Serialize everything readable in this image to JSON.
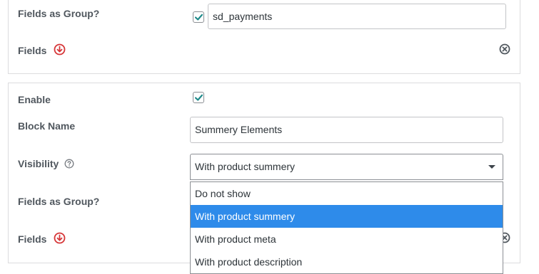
{
  "group1": {
    "fields_as_group_label": "Fields as Group?",
    "fields_as_group_checked": true,
    "group_value": "sd_payments",
    "fields_label": "Fields"
  },
  "group2": {
    "enable_label": "Enable",
    "enable_checked": true,
    "block_name_label": "Block Name",
    "block_name_value": "Summery Elements",
    "visibility_label": "Visibility",
    "visibility_selected": "With product summery",
    "visibility_options": [
      "Do not show",
      "With product summery",
      "With product meta",
      "With product description"
    ],
    "fields_as_group_label": "Fields as Group?",
    "fields_label": "Fields"
  },
  "colors": {
    "checkmark": "#1e8a8a",
    "alert_icon": "#d63638",
    "selected_option_bg": "#2e8bea",
    "label_text": "#50575e"
  },
  "icons": {
    "checkbox_mark": "checkmark-icon",
    "fields_toggle": "arrow-circle-down-icon",
    "remove": "close-circle-icon",
    "help": "help-icon",
    "dropdown": "caret-down-icon"
  }
}
